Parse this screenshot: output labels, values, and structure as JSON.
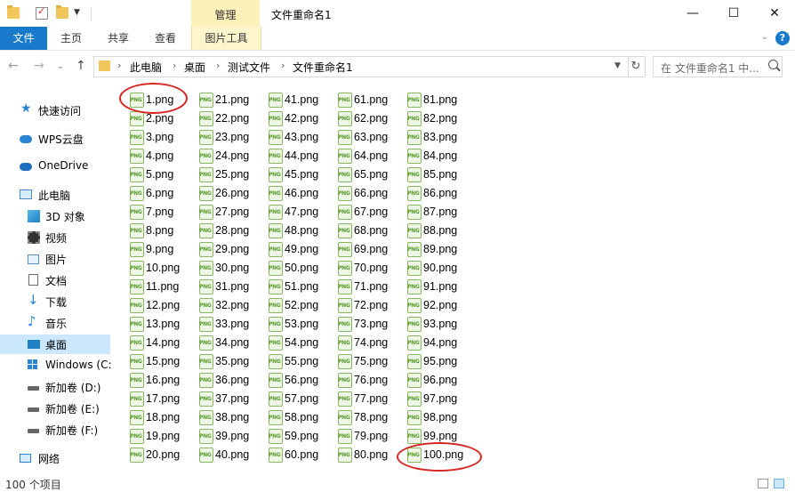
{
  "window": {
    "title": "文件重命名1",
    "context_tab_header": "管理",
    "controls": {
      "minimize": "—",
      "maximize": "☐",
      "close": "✕"
    }
  },
  "ribbon": {
    "tabs": [
      {
        "label": "文件"
      },
      {
        "label": "主页"
      },
      {
        "label": "共享"
      },
      {
        "label": "查看"
      },
      {
        "label": "图片工具"
      }
    ],
    "help": "?",
    "collapse": "⌄"
  },
  "address_bar": {
    "breadcrumbs": [
      "此电脑",
      "桌面",
      "测试文件",
      "文件重命名1"
    ],
    "search_placeholder": "在 文件重命名1 中..."
  },
  "sidebar": {
    "items": [
      {
        "label": "快速访问",
        "icon": "star-icon"
      },
      {
        "label": "WPS云盘",
        "icon": "cloud-icon"
      },
      {
        "label": "OneDrive",
        "icon": "cloud-icon"
      },
      {
        "label": "此电脑",
        "icon": "computer-icon"
      },
      {
        "label": "3D 对象",
        "icon": "cube-icon"
      },
      {
        "label": "视频",
        "icon": "video-icon"
      },
      {
        "label": "图片",
        "icon": "picture-icon"
      },
      {
        "label": "文档",
        "icon": "document-icon"
      },
      {
        "label": "下载",
        "icon": "download-icon"
      },
      {
        "label": "音乐",
        "icon": "music-icon"
      },
      {
        "label": "桌面",
        "icon": "desktop-icon",
        "selected": true
      },
      {
        "label": "Windows (C:",
        "icon": "windows-drive-icon"
      },
      {
        "label": "新加卷 (D:)",
        "icon": "drive-icon"
      },
      {
        "label": "新加卷 (E:)",
        "icon": "drive-icon"
      },
      {
        "label": "新加卷 (F:)",
        "icon": "drive-icon"
      },
      {
        "label": "网络",
        "icon": "network-icon"
      }
    ]
  },
  "files": [
    "1.png",
    "2.png",
    "3.png",
    "4.png",
    "5.png",
    "6.png",
    "7.png",
    "8.png",
    "9.png",
    "10.png",
    "11.png",
    "12.png",
    "13.png",
    "14.png",
    "15.png",
    "16.png",
    "17.png",
    "18.png",
    "19.png",
    "20.png",
    "21.png",
    "22.png",
    "23.png",
    "24.png",
    "25.png",
    "26.png",
    "27.png",
    "28.png",
    "29.png",
    "30.png",
    "31.png",
    "32.png",
    "33.png",
    "34.png",
    "35.png",
    "36.png",
    "37.png",
    "38.png",
    "39.png",
    "40.png",
    "41.png",
    "42.png",
    "43.png",
    "44.png",
    "45.png",
    "46.png",
    "47.png",
    "48.png",
    "49.png",
    "50.png",
    "51.png",
    "52.png",
    "53.png",
    "54.png",
    "55.png",
    "56.png",
    "57.png",
    "58.png",
    "59.png",
    "60.png",
    "61.png",
    "62.png",
    "63.png",
    "64.png",
    "65.png",
    "66.png",
    "67.png",
    "68.png",
    "69.png",
    "70.png",
    "71.png",
    "72.png",
    "73.png",
    "74.png",
    "75.png",
    "76.png",
    "77.png",
    "78.png",
    "79.png",
    "80.png",
    "81.png",
    "82.png",
    "83.png",
    "84.png",
    "85.png",
    "86.png",
    "87.png",
    "88.png",
    "89.png",
    "90.png",
    "91.png",
    "92.png",
    "93.png",
    "94.png",
    "95.png",
    "96.png",
    "97.png",
    "98.png",
    "99.png",
    "100.png"
  ],
  "status": {
    "item_count": "100 个项目"
  },
  "colors": {
    "accent": "#1979ca",
    "selected": "#cce8ff",
    "context_tab": "#fcf1b9",
    "annotation": "#d42520"
  }
}
